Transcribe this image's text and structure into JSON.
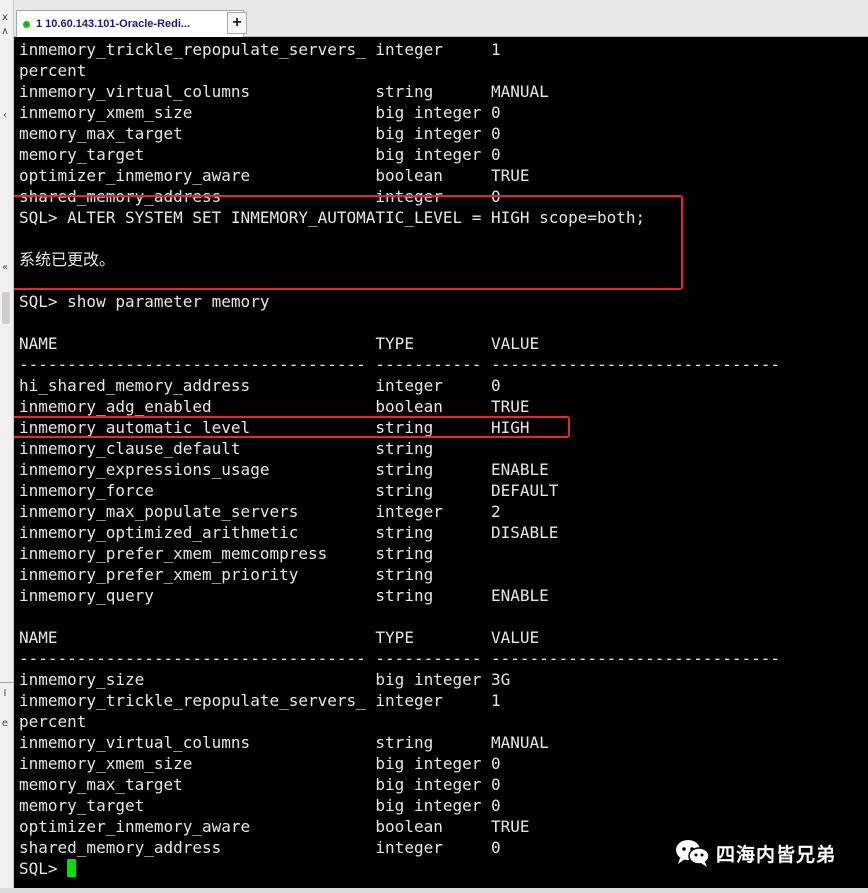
{
  "tab": {
    "title": "1 10.60.143.101-Oracle-Redi...",
    "add_label": "+"
  },
  "gutter_marks": [
    "x",
    "∧",
    "‹",
    "«",
    "I",
    "e"
  ],
  "colors": {
    "terminal_bg": "#000000",
    "terminal_fg": "#e6e6e6",
    "cursor": "#00e000",
    "highlight": "#e8262b",
    "tab_status_dot": "#19b919"
  },
  "terminal": {
    "lines": [
      "inmemory_trickle_repopulate_servers_ integer     1",
      "percent",
      "inmemory_virtual_columns             string      MANUAL",
      "inmemory_xmem_size                   big integer 0",
      "memory_max_target                    big integer 0",
      "memory_target                        big integer 0",
      "optimizer_inmemory_aware             boolean     TRUE",
      "shared_memory_address                integer     0",
      "SQL> ALTER SYSTEM SET INMEMORY_AUTOMATIC_LEVEL = HIGH scope=both;",
      "",
      "系统已更改。",
      "",
      "SQL> show parameter memory",
      "",
      "NAME                                 TYPE        VALUE",
      "------------------------------------ ----------- ------------------------------",
      "hi_shared_memory_address             integer     0",
      "inmemory_adg_enabled                 boolean     TRUE",
      "inmemory_automatic_level             string      HIGH",
      "inmemory_clause_default              string",
      "inmemory_expressions_usage           string      ENABLE",
      "inmemory_force                       string      DEFAULT",
      "inmemory_max_populate_servers        integer     2",
      "inmemory_optimized_arithmetic        string      DISABLE",
      "inmemory_prefer_xmem_memcompress     string",
      "inmemory_prefer_xmem_priority        string",
      "inmemory_query                       string      ENABLE",
      "",
      "NAME                                 TYPE        VALUE",
      "------------------------------------ ----------- ------------------------------",
      "inmemory_size                        big integer 3G",
      "inmemory_trickle_repopulate_servers_ integer     1",
      "percent",
      "inmemory_virtual_columns             string      MANUAL",
      "inmemory_xmem_size                   big integer 0",
      "memory_max_target                    big integer 0",
      "memory_target                        big integer 0",
      "optimizer_inmemory_aware             boolean     TRUE",
      "shared_memory_address                integer     0"
    ],
    "prompt": "SQL> "
  },
  "watermark": {
    "text": "四海内皆兄弟",
    "icon": "wechat-icon"
  }
}
